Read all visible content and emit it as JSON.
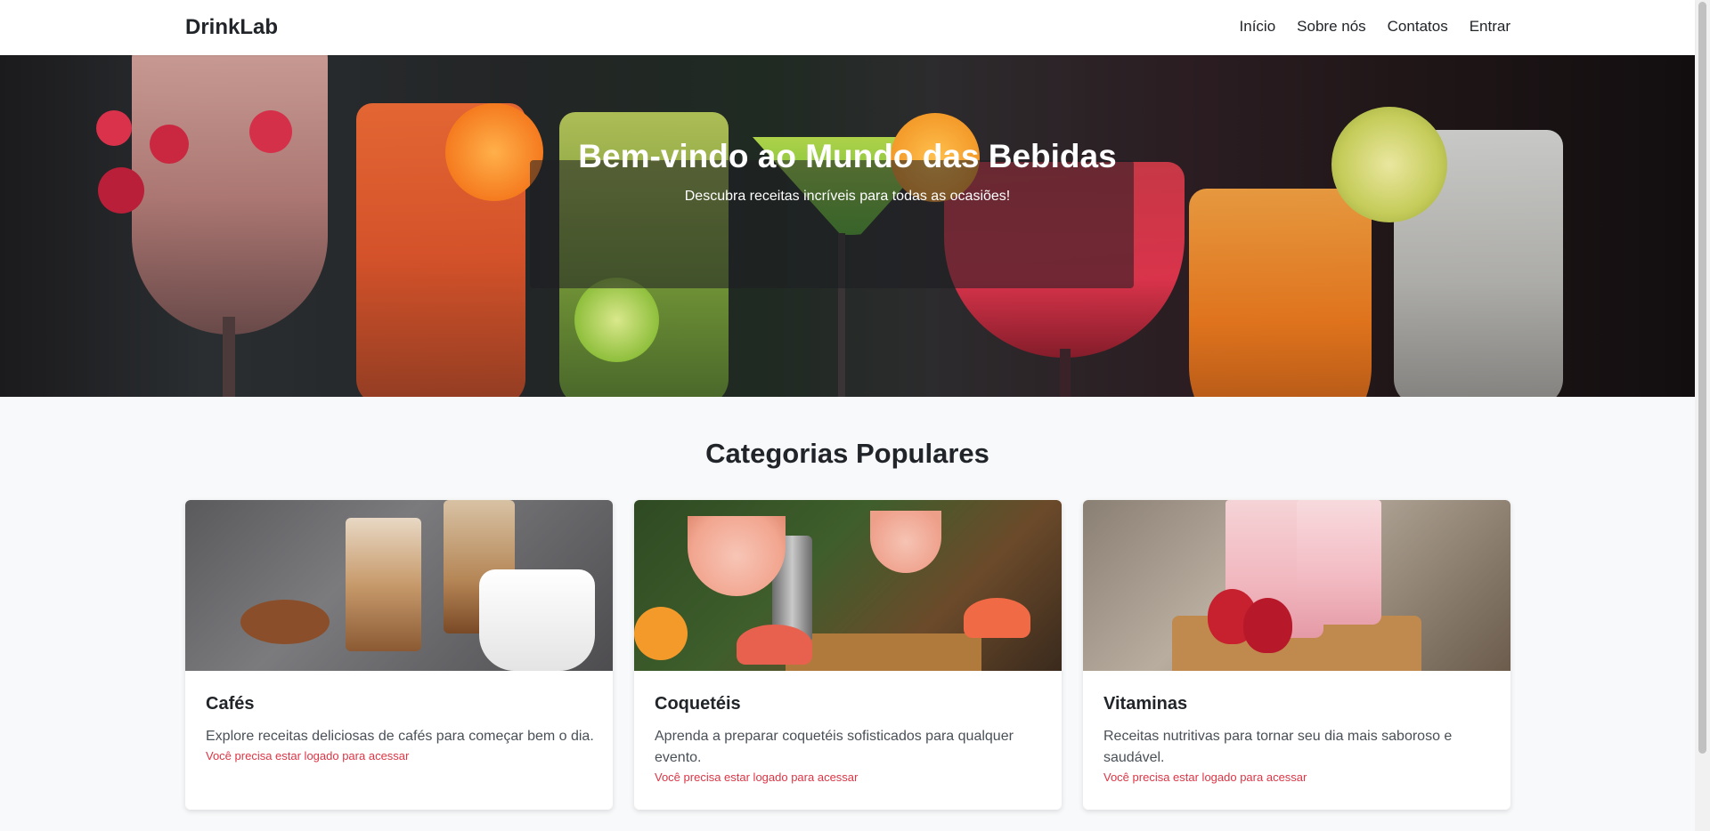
{
  "navbar": {
    "brand": "DrinkLab",
    "links": [
      "Início",
      "Sobre nós",
      "Contatos",
      "Entrar"
    ]
  },
  "hero": {
    "title": "Bem-vindo ao Mundo das Bebidas",
    "subtitle": "Descubra receitas incríveis para todas as ocasiões!"
  },
  "categories": {
    "title": "Categorias Populares",
    "cards": [
      {
        "title": "Cafés",
        "text": "Explore receitas deliciosas de cafés para começar bem o dia.",
        "login_notice": "Você precisa estar logado para acessar"
      },
      {
        "title": "Coquetéis",
        "text": "Aprenda a preparar coquetéis sofisticados para qualquer evento.",
        "login_notice": "Você precisa estar logado para acessar"
      },
      {
        "title": "Vitaminas",
        "text": "Receitas nutritivas para tornar seu dia mais saboroso e saudável.",
        "login_notice": "Você precisa estar logado para acessar"
      }
    ]
  },
  "colors": {
    "link_warning": "#dc3545",
    "text_dark": "#212529",
    "page_bg": "#f8f9fa"
  }
}
